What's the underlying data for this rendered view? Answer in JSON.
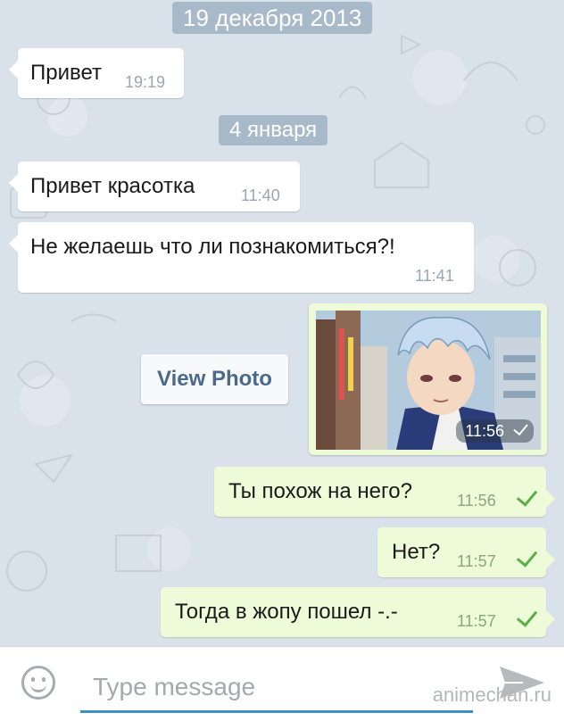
{
  "chat": {
    "date_1": "19 декабря 2013",
    "date_2": "4 января",
    "messages": [
      {
        "text": "Привет",
        "time": "19:19"
      },
      {
        "text": "Привет красотка",
        "time": "11:40"
      },
      {
        "text": "Не желаешь что ли познакомиться?!",
        "time": "11:41"
      },
      {
        "text": "Ты похож на него?",
        "time": "11:56"
      },
      {
        "text": "Нет?",
        "time": "11:57"
      },
      {
        "text": "Тогда в жопу пошел -.-",
        "time": "11:57"
      }
    ],
    "photo": {
      "view_label": "View Photo",
      "time": "11:56"
    }
  },
  "input": {
    "placeholder": "Type message"
  },
  "watermark": "animechan.ru",
  "colors": {
    "background": "#d9e1ea",
    "incoming_bubble": "#ffffff",
    "outgoing_bubble": "#eefbd8",
    "date_pill": "#a8b9c9",
    "check": "#5cae4a",
    "accent": "#3c8fc4"
  },
  "icons": {
    "emoji": "smiley-icon",
    "send": "send-icon",
    "read": "check-icon"
  }
}
